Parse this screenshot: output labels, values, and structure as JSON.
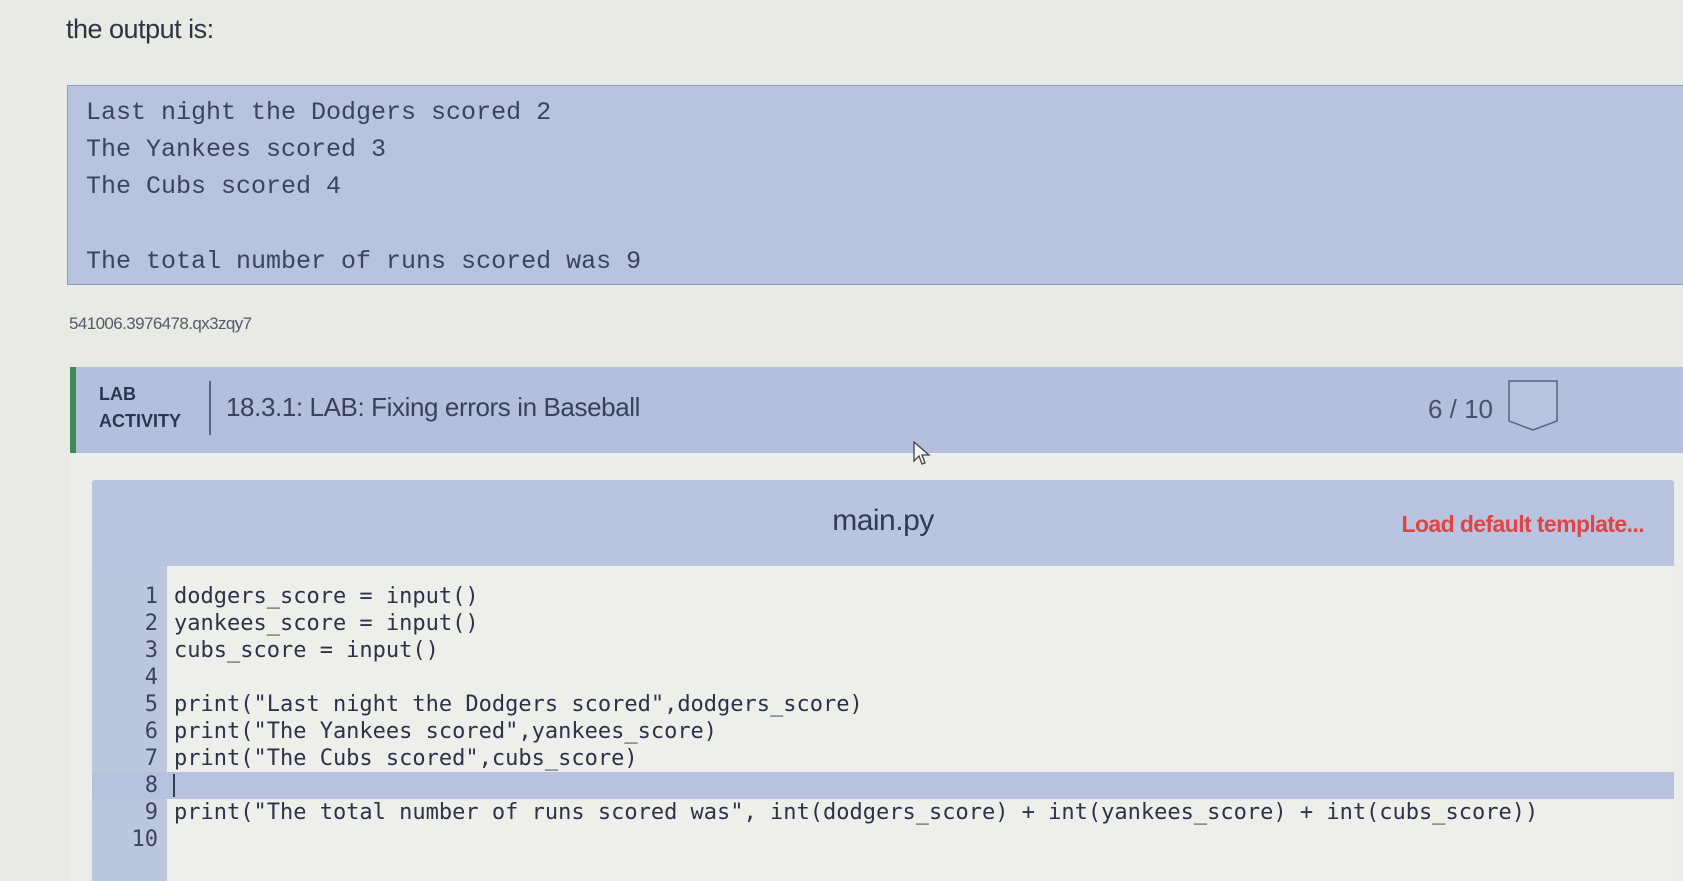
{
  "intro_text": "the output is:",
  "expected_output": {
    "lines": [
      "Last night the Dodgers scored 2",
      "The Yankees scored 3",
      "The Cubs scored 4",
      "",
      "The total number of runs scored was 9"
    ]
  },
  "activity_hash": "541006.3976478.qx3zqy7",
  "lab": {
    "kind_line1": "LAB",
    "kind_line2": "ACTIVITY",
    "title": "18.3.1: LAB: Fixing errors in Baseball",
    "score": "6 / 10",
    "badge_icon": "completion-badge-icon"
  },
  "editor": {
    "filename": "main.py",
    "load_default_label": "Load default template...",
    "active_line": 8,
    "lines": [
      {
        "num": "1",
        "code": "dodgers_score = input()"
      },
      {
        "num": "2",
        "code": "yankees_score = input()"
      },
      {
        "num": "3",
        "code": "cubs_score = input()"
      },
      {
        "num": "4",
        "code": ""
      },
      {
        "num": "5",
        "code": "print(\"Last night the Dodgers scored\",dodgers_score)"
      },
      {
        "num": "6",
        "code": "print(\"The Yankees scored\",yankees_score)"
      },
      {
        "num": "7",
        "code": "print(\"The Cubs scored\",cubs_score)"
      },
      {
        "num": "8",
        "code": ""
      },
      {
        "num": "9",
        "code": "print(\"The total number of runs scored was\", int(dodgers_score) + int(yankees_score) + int(cubs_score))"
      },
      {
        "num": "10",
        "code": ""
      }
    ]
  },
  "colors": {
    "accent_green": "#3f8a5a",
    "load_template_red": "#e04444",
    "panel_blue": "#b3bfdc"
  }
}
